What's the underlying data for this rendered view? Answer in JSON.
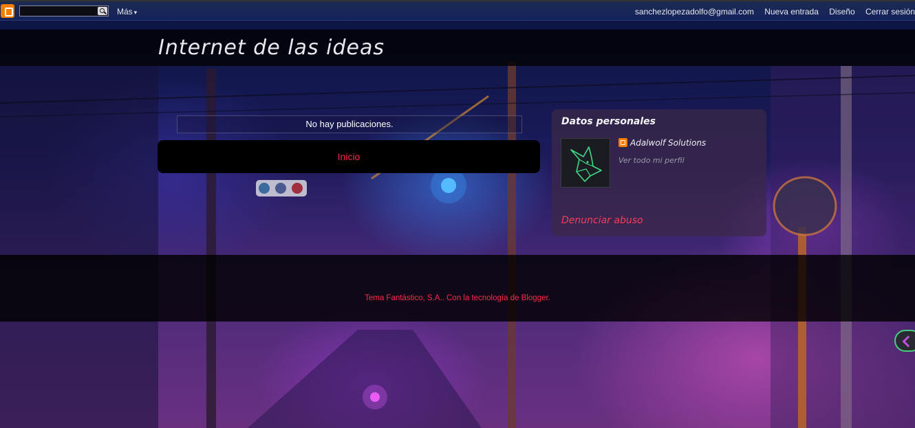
{
  "navbar": {
    "search_placeholder": "",
    "more_label": "Más",
    "more_caret": "▾",
    "account_email": "sanchezlopezadolfo@gmail.com",
    "new_post_label": "Nueva entrada",
    "design_label": "Diseño",
    "sign_out_label": "Cerrar sesión"
  },
  "header": {
    "blog_title": "Internet de las ideas"
  },
  "main": {
    "no_posts_message": "No hay publicaciones.",
    "home_link": "Inicio"
  },
  "sidebar": {
    "profile_widget": {
      "title": "Datos personales",
      "name": "Adalwolf Solutions",
      "view_profile_link": "Ver todo mi perfil",
      "report_abuse_link": "Denunciar abuso",
      "avatar_icon": "wolf-logo-icon"
    }
  },
  "footer": {
    "attribution": "Tema Fantástico, S.A.. Con la tecnología de Blogger."
  },
  "colors": {
    "accent_link": "#ff2a4a",
    "blogger_orange": "#f57d00",
    "avatar_line": "#3ddc84"
  }
}
